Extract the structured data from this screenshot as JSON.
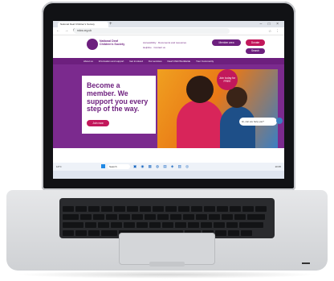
{
  "browser": {
    "tab_title": "National Deaf Children's Society",
    "url": "ndcs.org.uk"
  },
  "site": {
    "logo_text": "National Deaf Children's Society",
    "links": [
      "Accessibility",
      "Documents and resources",
      "Helpline",
      "Contact us"
    ],
    "buttons": {
      "member": "Member area",
      "donate": "Donate",
      "search": "Search"
    },
    "nav": [
      "About us",
      "Information and support",
      "Get involved",
      "Our services",
      "Deaf Child Worldwide",
      "Your Community"
    ]
  },
  "hero": {
    "title": "Become a member. We support you every step of the way.",
    "cta": "Join now",
    "badge": "Join today for FREE",
    "chat": "Hi, can we help you?"
  },
  "taskbar": {
    "weather": "14°C",
    "search_placeholder": "Search",
    "clock": "10:35"
  }
}
